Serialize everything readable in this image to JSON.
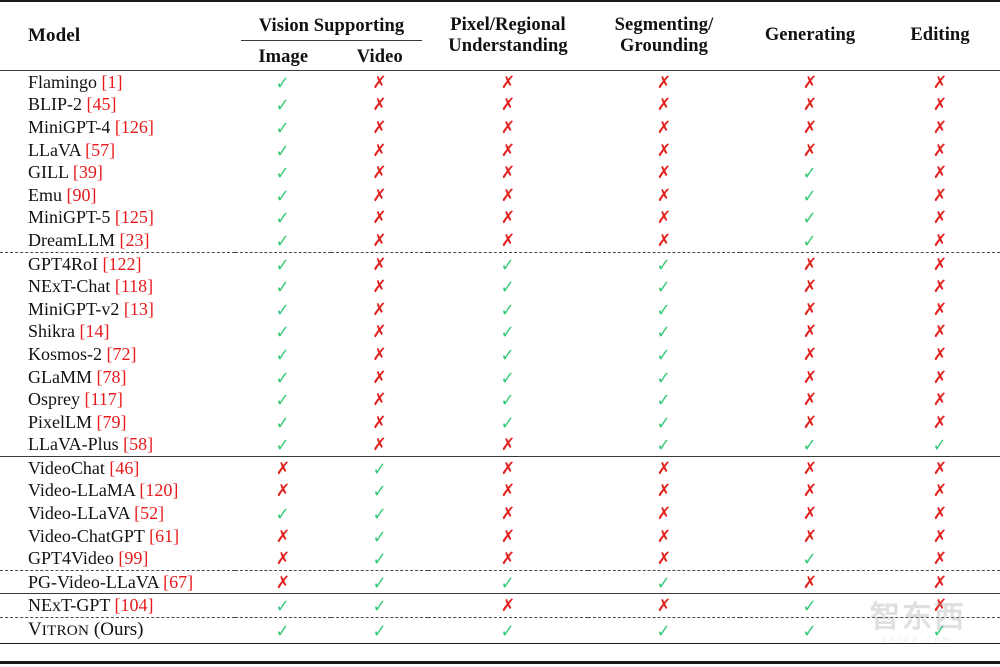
{
  "table": {
    "caption_columns": {
      "model": "Model",
      "vision_group": "Vision Supporting",
      "vision_image": "Image",
      "vision_video": "Video",
      "pixel_line1": "Pixel/Regional",
      "pixel_line2": "Understanding",
      "segment_line1": "Segmenting/",
      "segment_line2": "Grounding",
      "generating": "Generating",
      "editing": "Editing"
    },
    "marks": {
      "yes": "✓",
      "no": "✗"
    },
    "colors": {
      "yes": "#35c977",
      "no": "#e0221f",
      "citation": "#e8191b",
      "text": "#111111",
      "rule": "#1a1a1a"
    },
    "groups": [
      {
        "group_id": "image-llms",
        "separator_before": "none",
        "rows": [
          {
            "name": "Flamingo",
            "cite": "[1]",
            "image": "yes",
            "video": "no",
            "pixel": "no",
            "segment": "no",
            "generating": "no",
            "editing": "no"
          },
          {
            "name": "BLIP-2",
            "cite": "[45]",
            "image": "yes",
            "video": "no",
            "pixel": "no",
            "segment": "no",
            "generating": "no",
            "editing": "no"
          },
          {
            "name": "MiniGPT-4",
            "cite": "[126]",
            "image": "yes",
            "video": "no",
            "pixel": "no",
            "segment": "no",
            "generating": "no",
            "editing": "no"
          },
          {
            "name": "LLaVA",
            "cite": "[57]",
            "image": "yes",
            "video": "no",
            "pixel": "no",
            "segment": "no",
            "generating": "no",
            "editing": "no"
          },
          {
            "name": "GILL",
            "cite": "[39]",
            "image": "yes",
            "video": "no",
            "pixel": "no",
            "segment": "no",
            "generating": "yes",
            "editing": "no"
          },
          {
            "name": "Emu",
            "cite": "[90]",
            "image": "yes",
            "video": "no",
            "pixel": "no",
            "segment": "no",
            "generating": "yes",
            "editing": "no"
          },
          {
            "name": "MiniGPT-5",
            "cite": "[125]",
            "image": "yes",
            "video": "no",
            "pixel": "no",
            "segment": "no",
            "generating": "yes",
            "editing": "no"
          },
          {
            "name": "DreamLLM",
            "cite": "[23]",
            "image": "yes",
            "video": "no",
            "pixel": "no",
            "segment": "no",
            "generating": "yes",
            "editing": "no"
          }
        ]
      },
      {
        "group_id": "region-pixel-llms",
        "separator_before": "dashed",
        "rows": [
          {
            "name": "GPT4RoI",
            "cite": "[122]",
            "image": "yes",
            "video": "no",
            "pixel": "yes",
            "segment": "yes",
            "generating": "no",
            "editing": "no"
          },
          {
            "name": "NExT-Chat",
            "cite": "[118]",
            "image": "yes",
            "video": "no",
            "pixel": "yes",
            "segment": "yes",
            "generating": "no",
            "editing": "no"
          },
          {
            "name": "MiniGPT-v2",
            "cite": "[13]",
            "image": "yes",
            "video": "no",
            "pixel": "yes",
            "segment": "yes",
            "generating": "no",
            "editing": "no"
          },
          {
            "name": "Shikra",
            "cite": "[14]",
            "image": "yes",
            "video": "no",
            "pixel": "yes",
            "segment": "yes",
            "generating": "no",
            "editing": "no"
          },
          {
            "name": "Kosmos-2",
            "cite": "[72]",
            "image": "yes",
            "video": "no",
            "pixel": "yes",
            "segment": "yes",
            "generating": "no",
            "editing": "no"
          },
          {
            "name": "GLaMM",
            "cite": "[78]",
            "image": "yes",
            "video": "no",
            "pixel": "yes",
            "segment": "yes",
            "generating": "no",
            "editing": "no"
          },
          {
            "name": "Osprey",
            "cite": "[117]",
            "image": "yes",
            "video": "no",
            "pixel": "yes",
            "segment": "yes",
            "generating": "no",
            "editing": "no"
          },
          {
            "name": "PixelLM",
            "cite": "[79]",
            "image": "yes",
            "video": "no",
            "pixel": "yes",
            "segment": "yes",
            "generating": "no",
            "editing": "no"
          },
          {
            "name": "LLaVA-Plus",
            "cite": "[58]",
            "image": "yes",
            "video": "no",
            "pixel": "no",
            "segment": "yes",
            "generating": "yes",
            "editing": "yes"
          }
        ]
      },
      {
        "group_id": "video-llms",
        "separator_before": "solid",
        "rows": [
          {
            "name": "VideoChat",
            "cite": "[46]",
            "image": "no",
            "video": "yes",
            "pixel": "no",
            "segment": "no",
            "generating": "no",
            "editing": "no"
          },
          {
            "name": "Video-LLaMA",
            "cite": "[120]",
            "image": "no",
            "video": "yes",
            "pixel": "no",
            "segment": "no",
            "generating": "no",
            "editing": "no"
          },
          {
            "name": "Video-LLaVA",
            "cite": "[52]",
            "image": "yes",
            "video": "yes",
            "pixel": "no",
            "segment": "no",
            "generating": "no",
            "editing": "no"
          },
          {
            "name": "Video-ChatGPT",
            "cite": "[61]",
            "image": "no",
            "video": "yes",
            "pixel": "no",
            "segment": "no",
            "generating": "no",
            "editing": "no"
          },
          {
            "name": "GPT4Video",
            "cite": "[99]",
            "image": "no",
            "video": "yes",
            "pixel": "no",
            "segment": "no",
            "generating": "yes",
            "editing": "no"
          }
        ]
      },
      {
        "group_id": "video-grounding-llms",
        "separator_before": "dashed",
        "rows": [
          {
            "name": "PG-Video-LLaVA",
            "cite": "[67]",
            "image": "no",
            "video": "yes",
            "pixel": "yes",
            "segment": "yes",
            "generating": "no",
            "editing": "no"
          }
        ]
      },
      {
        "group_id": "any-to-any-llms",
        "separator_before": "solid",
        "rows": [
          {
            "name": "NExT-GPT",
            "cite": "[104]",
            "image": "yes",
            "video": "yes",
            "pixel": "no",
            "segment": "no",
            "generating": "yes",
            "editing": "no"
          }
        ]
      },
      {
        "group_id": "ours",
        "separator_before": "dashed",
        "rows": [
          {
            "name": "VITRON (Ours)",
            "cite": "",
            "smallcaps": true,
            "image": "yes",
            "video": "yes",
            "pixel": "yes",
            "segment": "yes",
            "generating": "yes",
            "editing": "yes"
          }
        ]
      }
    ]
  },
  "watermark": {
    "chinese": "智东西",
    "latin": "zhidx.com"
  }
}
